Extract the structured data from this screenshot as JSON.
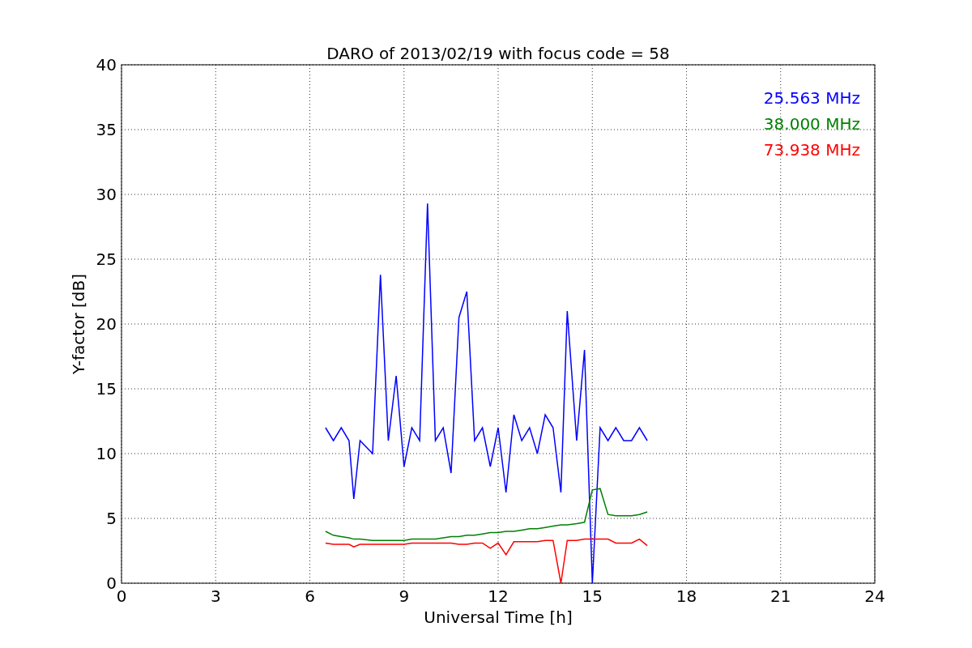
{
  "chart_data": {
    "type": "line",
    "title": "DARO of 2013/02/19 with focus code = 58",
    "xlabel": "Universal Time [h]",
    "ylabel": "Y-factor [dB]",
    "x": [
      6.5,
      6.75,
      7.0,
      7.25,
      7.4,
      7.6,
      8.0,
      8.25,
      8.5,
      8.75,
      9.0,
      9.25,
      9.5,
      9.75,
      10.0,
      10.25,
      10.5,
      10.75,
      11.0,
      11.25,
      11.5,
      11.75,
      12.0,
      12.25,
      12.5,
      12.75,
      13.0,
      13.25,
      13.5,
      13.75,
      14.0,
      14.2,
      14.5,
      14.75,
      15.0,
      15.25,
      15.5,
      15.75,
      16.0,
      16.25,
      16.5,
      16.75
    ],
    "series": [
      {
        "name": "25.563 MHz",
        "color": "#0000ff",
        "values": [
          12,
          11,
          12,
          11,
          6.5,
          11,
          10,
          23.8,
          11,
          16,
          9,
          12,
          11,
          29.3,
          11,
          12,
          8.5,
          20.5,
          22.5,
          11,
          12,
          9,
          12,
          7,
          13,
          11,
          12,
          10,
          13,
          12,
          7,
          21,
          11,
          18,
          0,
          12,
          11,
          12,
          11,
          11,
          12,
          11
        ]
      },
      {
        "name": "38.000 MHz",
        "color": "#008000",
        "values": [
          4,
          3.7,
          3.6,
          3.5,
          3.4,
          3.4,
          3.3,
          3.3,
          3.3,
          3.3,
          3.3,
          3.4,
          3.4,
          3.4,
          3.4,
          3.5,
          3.6,
          3.6,
          3.7,
          3.7,
          3.8,
          3.9,
          3.9,
          4.0,
          4.0,
          4.1,
          4.2,
          4.2,
          4.3,
          4.4,
          4.5,
          4.5,
          4.6,
          4.7,
          7.2,
          7.3,
          5.3,
          5.2,
          5.2,
          5.2,
          5.3,
          5.5
        ]
      },
      {
        "name": "73.938 MHz",
        "color": "#ff0000",
        "values": [
          3.1,
          3.0,
          3.0,
          3.0,
          2.8,
          3.0,
          3.0,
          3.0,
          3.0,
          3.0,
          3.0,
          3.1,
          3.1,
          3.1,
          3.1,
          3.1,
          3.1,
          3.0,
          3.0,
          3.1,
          3.1,
          2.7,
          3.1,
          2.2,
          3.2,
          3.2,
          3.2,
          3.2,
          3.3,
          3.3,
          0,
          3.3,
          3.3,
          3.4,
          3.4,
          3.4,
          3.4,
          3.1,
          3.1,
          3.1,
          3.4,
          2.9
        ]
      }
    ],
    "xlim": [
      0,
      24
    ],
    "ylim": [
      0,
      40
    ],
    "xticks": [
      0,
      3,
      6,
      9,
      12,
      15,
      18,
      21,
      24
    ],
    "yticks": [
      0,
      5,
      10,
      15,
      20,
      25,
      30,
      35,
      40
    ],
    "grid": true
  }
}
